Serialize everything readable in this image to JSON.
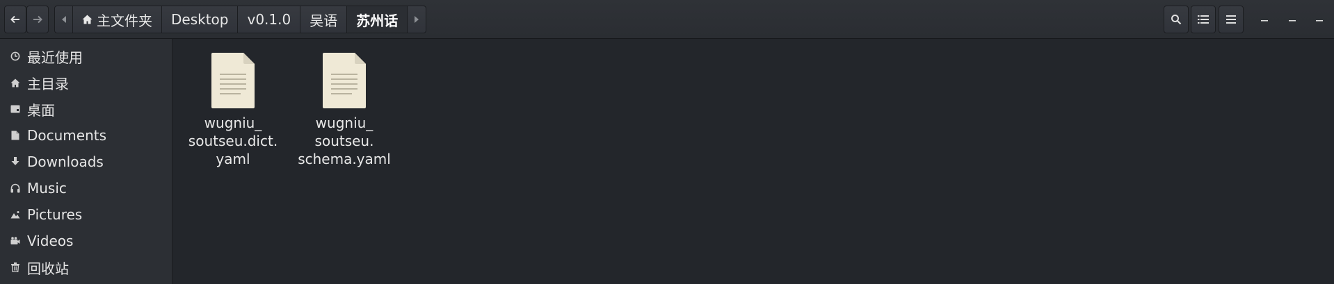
{
  "header": {
    "back_label": "←",
    "forward_label": "→",
    "path_scroll_left": "◂",
    "path_scroll_right": "▸",
    "breadcrumbs": [
      {
        "label": "主文件夹"
      },
      {
        "label": "Desktop"
      },
      {
        "label": "v0.1.0"
      },
      {
        "label": "吴语"
      },
      {
        "label": "苏州话"
      }
    ],
    "tool_icons": [
      "search-icon",
      "list-view-icon",
      "menu-icon"
    ],
    "window_controls": [
      "minimize-icon",
      "minimize-icon",
      "maximize-icon"
    ]
  },
  "sidebar": {
    "items": [
      {
        "label": "最近使用",
        "icon": "recent-icon"
      },
      {
        "label": "主目录",
        "icon": "home-icon"
      },
      {
        "label": "桌面",
        "icon": "desktop-icon"
      },
      {
        "label": "Documents",
        "icon": "document-icon"
      },
      {
        "label": "Downloads",
        "icon": "download-icon"
      },
      {
        "label": "Music",
        "icon": "music-icon"
      },
      {
        "label": "Pictures",
        "icon": "pictures-icon"
      },
      {
        "label": "Videos",
        "icon": "video-icon"
      },
      {
        "label": "回收站",
        "icon": "trash-icon"
      }
    ]
  },
  "files": [
    {
      "line1": "wugniu_",
      "line2": "soutseu.dict.",
      "line3": "yaml"
    },
    {
      "line1": "wugniu_",
      "line2": "soutseu.",
      "line3": "schema.yaml"
    }
  ],
  "colors": {
    "background": "#23262b",
    "sidebar": "#2c2f34",
    "headerbar": "#2f3237",
    "file_icon": "#efe9d6"
  }
}
